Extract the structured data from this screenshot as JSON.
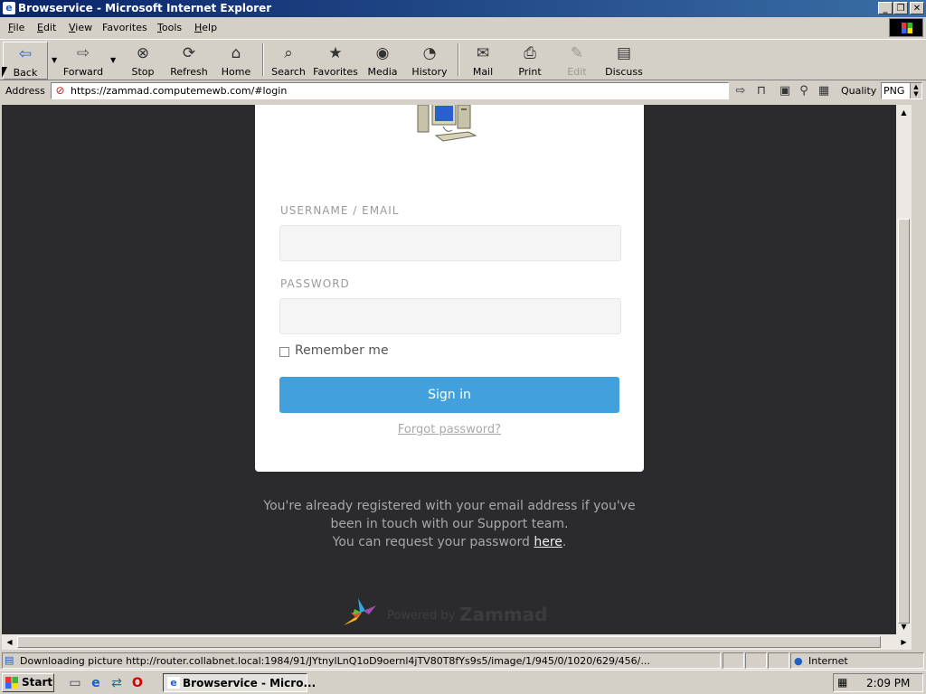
{
  "window": {
    "title": "Browservice - Microsoft Internet Explorer",
    "controls": [
      "_",
      "❐",
      "✕"
    ]
  },
  "menu": {
    "items": [
      {
        "key": "F",
        "rest": "ile"
      },
      {
        "key": "E",
        "rest": "dit"
      },
      {
        "key": "V",
        "rest": "iew"
      },
      {
        "key": "",
        "rest": "Favorites"
      },
      {
        "key": "T",
        "rest": "ools"
      },
      {
        "key": "H",
        "rest": "elp"
      }
    ]
  },
  "toolbar": {
    "back": "Back",
    "forward": "Forward",
    "stop": "Stop",
    "refresh": "Refresh",
    "home": "Home",
    "search": "Search",
    "favorites": "Favorites",
    "media": "Media",
    "history": "History",
    "mail": "Mail",
    "print": "Print",
    "edit": "Edit",
    "discuss": "Discuss"
  },
  "address": {
    "label": "Address",
    "url": "https://zammad.computemewb.com/#login",
    "quality_label": "Quality",
    "quality_value": "PNG"
  },
  "login": {
    "username_label": "USERNAME / EMAIL",
    "password_label": "PASSWORD",
    "remember_label": "Remember me",
    "signin_label": "Sign in",
    "forgot_label": "Forgot password?",
    "info_line1": "You're already registered with your email address if you've",
    "info_line2": "been in touch with our Support team.",
    "info_line3_prefix": "You can request your password",
    "info_line3_link": "here",
    "info_line3_suffix": ".",
    "powered_by": "Powered by",
    "brand": "Zammad"
  },
  "status": {
    "text": "Downloading picture http://router.collabnet.local:1984/91/JYtnylLnQ1oD9oernl4jTV80T8fYs9s5/image/1/945/0/1020/629/456/...",
    "zone": "Internet"
  },
  "taskbar": {
    "start": "Start",
    "task": "Browservice - Micro...",
    "clock": "2:09 PM"
  },
  "colors": {
    "titlebar": "#0a246a",
    "page_background": "#2b2b2e",
    "signin_button": "#42a0dc"
  }
}
